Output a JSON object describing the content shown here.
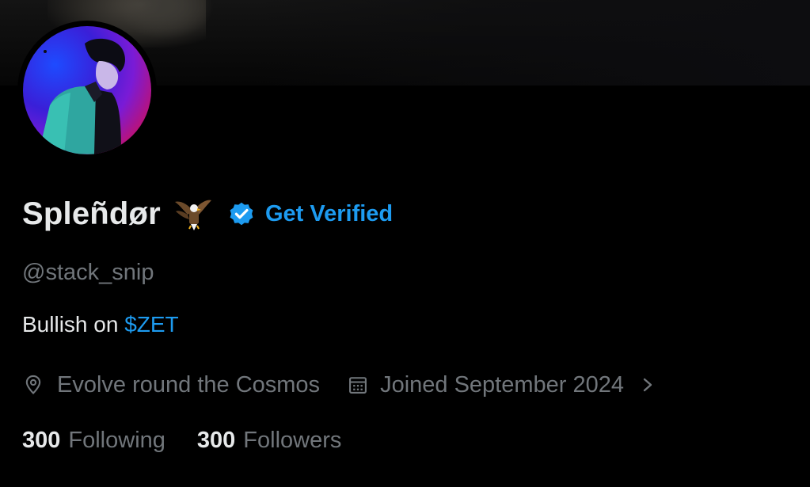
{
  "profile": {
    "display_name": "Spleñdør",
    "verify_label": "Get Verified",
    "handle": "@stack_snip",
    "bio_prefix": "Bullish on ",
    "bio_cashtag": "$ZET",
    "location": "Evolve round the Cosmos",
    "joined": "Joined September 2024",
    "following_count": "300",
    "following_label": "Following",
    "followers_count": "300",
    "followers_label": "Followers"
  },
  "icons": {
    "name_emoji": "eagle-icon",
    "verified": "verified-badge-icon",
    "location": "location-pin-icon",
    "joined": "calendar-icon",
    "expand": "chevron-right-icon"
  },
  "colors": {
    "background": "#000000",
    "primary_text": "#e7e9ea",
    "secondary_text": "#71767b",
    "accent": "#1d9bf0"
  }
}
